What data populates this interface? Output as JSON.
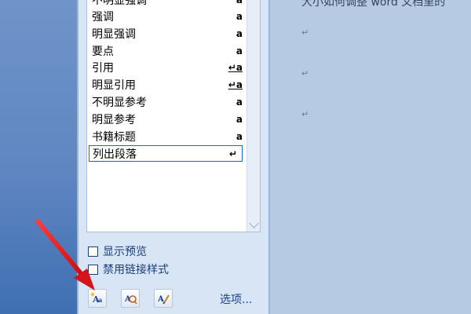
{
  "styles_pane": {
    "items": [
      {
        "label": "不明显强调",
        "glyph": "a",
        "link": false
      },
      {
        "label": "强调",
        "glyph": "a",
        "link": false
      },
      {
        "label": "明显强调",
        "glyph": "a",
        "link": false
      },
      {
        "label": "要点",
        "glyph": "a",
        "link": false
      },
      {
        "label": "引用",
        "glyph": "↵a",
        "link": true
      },
      {
        "label": "明显引用",
        "glyph": "↵a",
        "link": true
      },
      {
        "label": "不明显参考",
        "glyph": "a",
        "link": false
      },
      {
        "label": "明显参考",
        "glyph": "a",
        "link": false
      },
      {
        "label": "书籍标题",
        "glyph": "a",
        "link": false
      },
      {
        "label": "列出段落",
        "glyph": "↵",
        "link": false
      }
    ],
    "show_preview_label": "显示预览",
    "disable_linked_styles_label": "禁用链接样式",
    "options_label": "选项..."
  },
  "document": {
    "first_line": "大小如何调整 word 文档里的",
    "paragraph_mark": "↵"
  },
  "colors": {
    "pane_bg": "#d7e5f5",
    "doc_bg": "#b6cbe3",
    "arrow": "#e8141a",
    "selected_border": "#1e67c5"
  }
}
